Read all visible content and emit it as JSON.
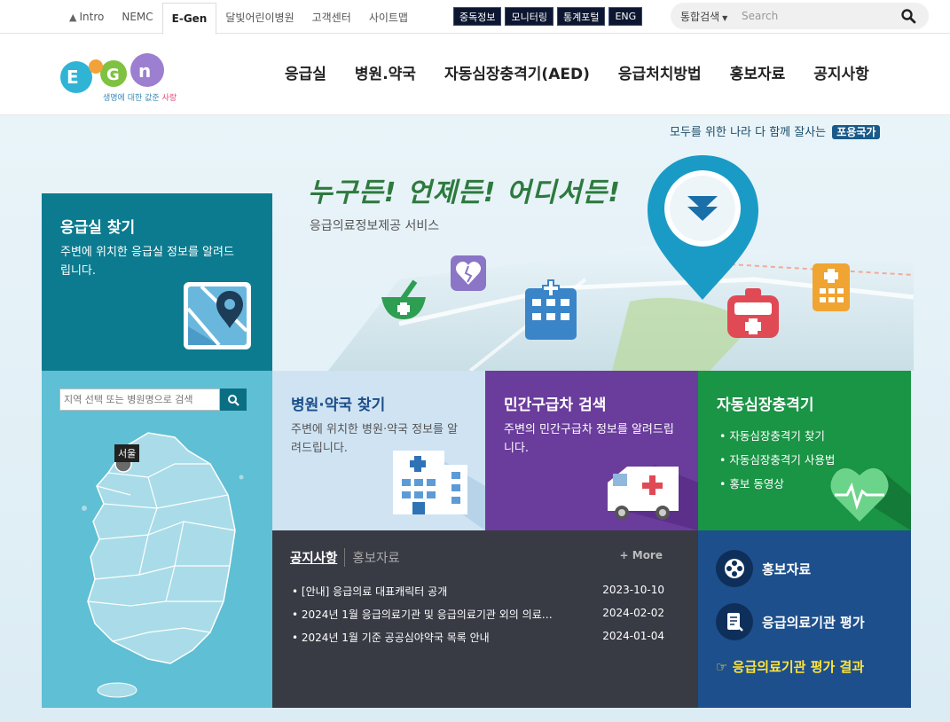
{
  "topbar": {
    "links": [
      "Intro",
      "NEMC",
      "E-Gen",
      "달빛어린이병원",
      "고객센터",
      "사이트맵"
    ],
    "dark_buttons": [
      "중독정보",
      "모니터링",
      "통계포털",
      "ENG"
    ],
    "search": {
      "scope": "통합검색",
      "placeholder": "Search"
    }
  },
  "header": {
    "logo_text": "E-Gen",
    "logo_tag_a": "생명에 대한 값준 ",
    "logo_tag_b": "사랑",
    "nav": [
      "응급실",
      "병원.약국",
      "자동심장충격기(AED)",
      "응급처치방법",
      "홍보자료",
      "공지사항"
    ]
  },
  "hero": {
    "slogan": "모두를 위한 나라 다 함께 잘사는",
    "slogan_badge": "포용국가",
    "title": "누구든! 언제든! 어디서든!",
    "subtitle": "응급의료정보제공 서비스"
  },
  "er_panel": {
    "title": "응급실 찾기",
    "desc": "주변에 위치한 응급실 정보를 알려드립니다."
  },
  "map": {
    "search_placeholder": "지역 선택 또는 병원명으로 검색",
    "region_label": "서울"
  },
  "tiles": {
    "hospital": {
      "title": "병원·약국 찾기",
      "desc": "주변에 위치한 병원·약국 정보를 알려드립니다."
    },
    "ambulance": {
      "title": "민간구급차 검색",
      "desc": "주변의 민간구급차 정보를 알려드립니다."
    },
    "aed": {
      "title": "자동심장충격기",
      "items": [
        "자동심장충격기 찾기",
        "자동심장충격기 사용법",
        "홍보 동영상"
      ]
    }
  },
  "notice": {
    "tab_active": "공지사항",
    "tab_inactive": "홍보자료",
    "more": "+ More",
    "items": [
      {
        "title": "[안내] 응급의료 대표캐릭터 공개",
        "date": "2023-10-10"
      },
      {
        "title": "2024년 1월 응급의료기관 및 응급의료기관 외의 의료…",
        "date": "2024-02-02"
      },
      {
        "title": "2024년 1월 기준 공공심야약국 목록 안내",
        "date": "2024-01-04"
      }
    ]
  },
  "promo": {
    "item1": "홍보자료",
    "item2": "응급의료기관 평가",
    "link": "☞ 응급의료기관 평가 결과"
  },
  "colors": {
    "er_teal": "#0c7b8f",
    "map_blue": "#5fbfd4",
    "hospital_tile": "#cfe3f2",
    "ambulance_purple": "#6a3c9c",
    "aed_green": "#1a9445",
    "notice_dark": "#383a44",
    "promo_blue": "#1d4f8c",
    "highlight_yellow": "#ffe43a"
  }
}
